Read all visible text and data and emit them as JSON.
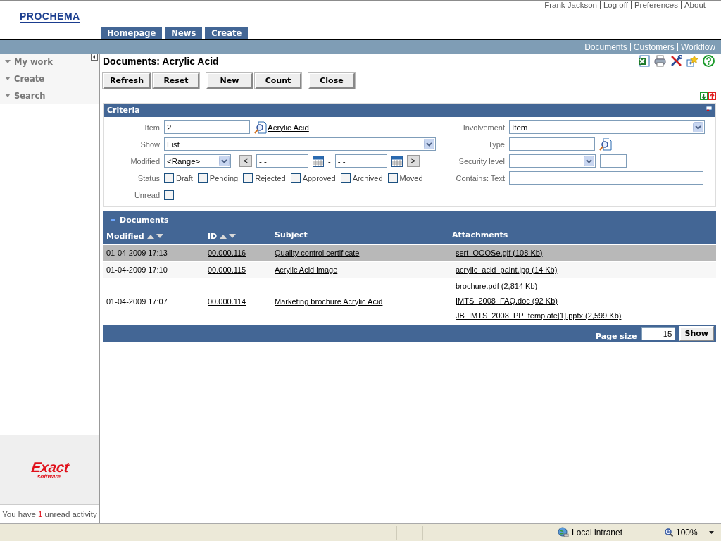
{
  "header": {
    "logo": "PROCHEMA",
    "user_links": [
      "Frank Jackson",
      "Log off",
      "Preferences",
      "About"
    ],
    "tabs": [
      {
        "label": "Homepage"
      },
      {
        "label": "News"
      },
      {
        "label": "Create"
      }
    ]
  },
  "nav_links": [
    "Documents",
    "Customers",
    "Workflow"
  ],
  "sidebar": {
    "items": [
      {
        "label": "My work"
      },
      {
        "label": "Create"
      },
      {
        "label": "Search"
      }
    ],
    "logo": {
      "brand": "Exact",
      "sub": "software"
    },
    "notice": {
      "before": "You have",
      "count": "1",
      "after": "unread activity"
    }
  },
  "page": {
    "title": "Documents: Acrylic Acid",
    "toolbar": [
      "Refresh",
      "Reset",
      "New",
      "Count",
      "Close"
    ]
  },
  "criteria": {
    "title": "Criteria",
    "left_fields": [
      {
        "kind": "lookup",
        "label": "Item",
        "value": "2",
        "link": "Acrylic Acid"
      },
      {
        "kind": "select",
        "label": "Show",
        "value": "List"
      },
      {
        "kind": "range",
        "label": "Modified",
        "select_value": "<Range>",
        "prev": "<",
        "from_value": "- -",
        "separator": "-",
        "to_value": "- -",
        "next": ">"
      },
      {
        "kind": "checkboxes",
        "label": "Status",
        "options": [
          {
            "label": "Draft",
            "checked": false
          },
          {
            "label": "Pending",
            "checked": false
          },
          {
            "label": "Rejected",
            "checked": false
          },
          {
            "label": "Approved",
            "checked": false
          },
          {
            "label": "Archived",
            "checked": false
          },
          {
            "label": "Moved",
            "checked": false
          }
        ]
      },
      {
        "kind": "checkbox",
        "label": "Unread",
        "checked": false
      }
    ],
    "right_fields": [
      {
        "kind": "select",
        "label": "Involvement",
        "value": "Item"
      },
      {
        "kind": "lookup",
        "label": "Type"
      },
      {
        "kind": "select_small",
        "label": "Security level"
      },
      {
        "kind": "text",
        "label": "Contains: Text"
      }
    ]
  },
  "documents": {
    "title": "Documents",
    "columns": [
      {
        "label": "Modified",
        "sortable": true
      },
      {
        "label": "ID",
        "sortable": true
      },
      {
        "label": "Subject",
        "sortable": false
      },
      {
        "label": "Attachments",
        "sortable": false
      }
    ],
    "rows": [
      {
        "selected": true,
        "modified": "01-04-2009 17:13",
        "id": "00.000.116",
        "subject": "Quality control certificate",
        "attachments": [
          "sert_OOOSe.gif (108 Kb)"
        ]
      },
      {
        "selected": false,
        "modified": "01-04-2009 17:10",
        "id": "00.000.115",
        "subject": "Acrylic Acid image",
        "attachments": [
          "acrylic_acid_paint.jpg (14 Kb)"
        ]
      },
      {
        "selected": false,
        "modified": "01-04-2009 17:07",
        "id": "00.000.114",
        "subject": "Marketing brochure Acrylic Acid",
        "attachments": [
          "brochure.pdf (2,814 Kb)",
          "IMTS_2008_FAQ.doc (92 Kb)",
          "JB_IMTS_2008_PP_template[1].pptx (2,599 Kb)"
        ]
      }
    ],
    "page_size_label": "Page size",
    "page_size": "15",
    "show_button": "Show"
  },
  "status_bar": {
    "zone": "Local intranet",
    "zoom": "100%"
  }
}
